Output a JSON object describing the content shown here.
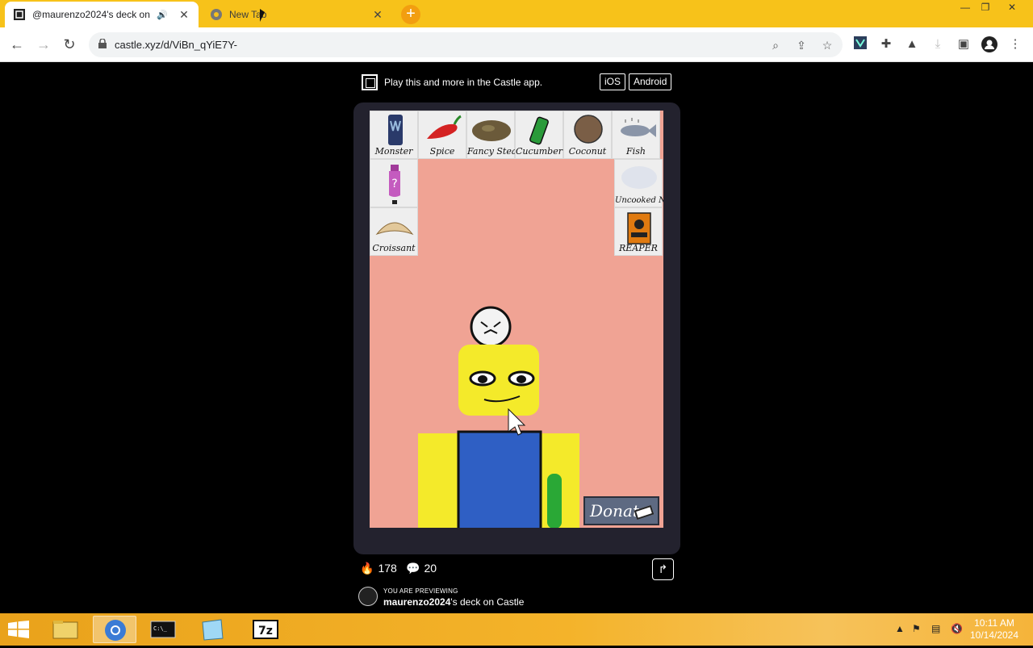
{
  "browser": {
    "tabs": [
      {
        "title": "@maurenzo2024's deck on",
        "active": true
      },
      {
        "title": "New Tab",
        "active": false
      }
    ],
    "new_tab": "+",
    "url": "castle.xyz/d/ViBn_qYiE7Y-",
    "window_controls": {
      "minimize": "—",
      "restore": "❐",
      "close": "✕"
    }
  },
  "banner": {
    "text": "Play this and more in the Castle app.",
    "ios": "iOS",
    "android": "Android"
  },
  "game": {
    "items": [
      {
        "label": "Monster",
        "icon": "monster-can-icon"
      },
      {
        "label": "Spice",
        "icon": "chili-pepper-icon"
      },
      {
        "label": "Fancy Steak",
        "icon": "steak-icon"
      },
      {
        "label": "Cucumber",
        "icon": "cucumber-icon"
      },
      {
        "label": "Coconut",
        "icon": "coconut-icon"
      },
      {
        "label": "Fish",
        "icon": "fish-icon"
      },
      {
        "label": "",
        "icon": "bottle-icon"
      },
      {
        "label": "Uncooked Noodles",
        "icon": "noodles-icon"
      },
      {
        "label": "Croissant",
        "icon": "croissant-icon"
      },
      {
        "label": "REAPER",
        "icon": "reaper-chips-icon"
      }
    ],
    "donate": "Donate",
    "colors": {
      "background": "#f0a394",
      "character_yellow": "#f4ea2a",
      "shirt_blue": "#2f5fc4"
    }
  },
  "stats": {
    "likes": "178",
    "comments": "20"
  },
  "preview": {
    "label": "YOU ARE PREVIEWING",
    "user": "maurenzo2024",
    "suffix": "'s deck on Castle"
  },
  "taskbar": {
    "time": "10:11 AM",
    "date": "10/14/2024",
    "apps": [
      "file-explorer-icon",
      "chrome-icon",
      "terminal-icon",
      "notepad-icon",
      "7zip-icon"
    ]
  }
}
